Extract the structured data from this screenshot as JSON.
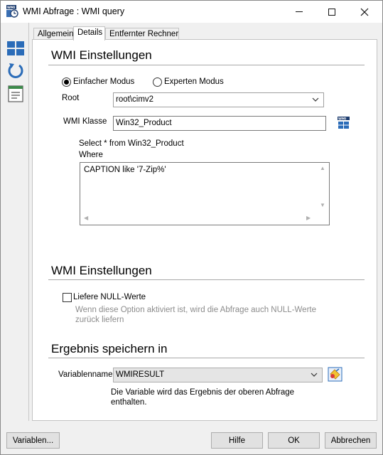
{
  "window": {
    "title": "WMI Abfrage : WMI query",
    "app_icon": "wmi-query-icon",
    "controls": {
      "minimize": "minimize-icon",
      "maximize": "maximize-icon",
      "close": "close-icon"
    }
  },
  "sidebar": {
    "icons": [
      "windows-tiles-icon",
      "refresh-icon",
      "document-list-icon"
    ]
  },
  "tabs": [
    {
      "label": "Allgemein",
      "active": false
    },
    {
      "label": "Details",
      "active": true
    },
    {
      "label": "Entfernter Rechner",
      "active": false
    }
  ],
  "wmi_settings": {
    "title": "WMI Einstellungen",
    "mode_simple": "Einfacher Modus",
    "mode_expert": "Experten Modus",
    "selected_mode": "simple",
    "root_label": "Root",
    "root_value": "root\\cimv2",
    "class_label": "WMI Klasse",
    "class_value": "Win32_Product",
    "query_preview": "Select * from Win32_Product",
    "where_label": "Where",
    "where_value": "CAPTION like  '7-Zip%'"
  },
  "null_settings": {
    "title": "WMI Einstellungen",
    "checkbox_label": "Liefere NULL-Werte",
    "checked": false,
    "hint": "Wenn diese Option aktiviert ist, wird die Abfrage auch NULL-Werte zurück liefern"
  },
  "result": {
    "title": "Ergebnis speichern in",
    "variable_label": "Variablenname",
    "variable_value": "WMIRESULT",
    "hint": "Die Variable wird das Ergebnis der oberen Abfrage enthalten."
  },
  "footer": {
    "variables_button": "Variablen...",
    "help_button": "Hilfe",
    "ok_button": "OK",
    "cancel_button": "Abbrechen"
  },
  "colors": {
    "accent_blue": "#2b6cb8",
    "panel_bg": "#ffffff",
    "window_bg": "#f0f0f0"
  }
}
